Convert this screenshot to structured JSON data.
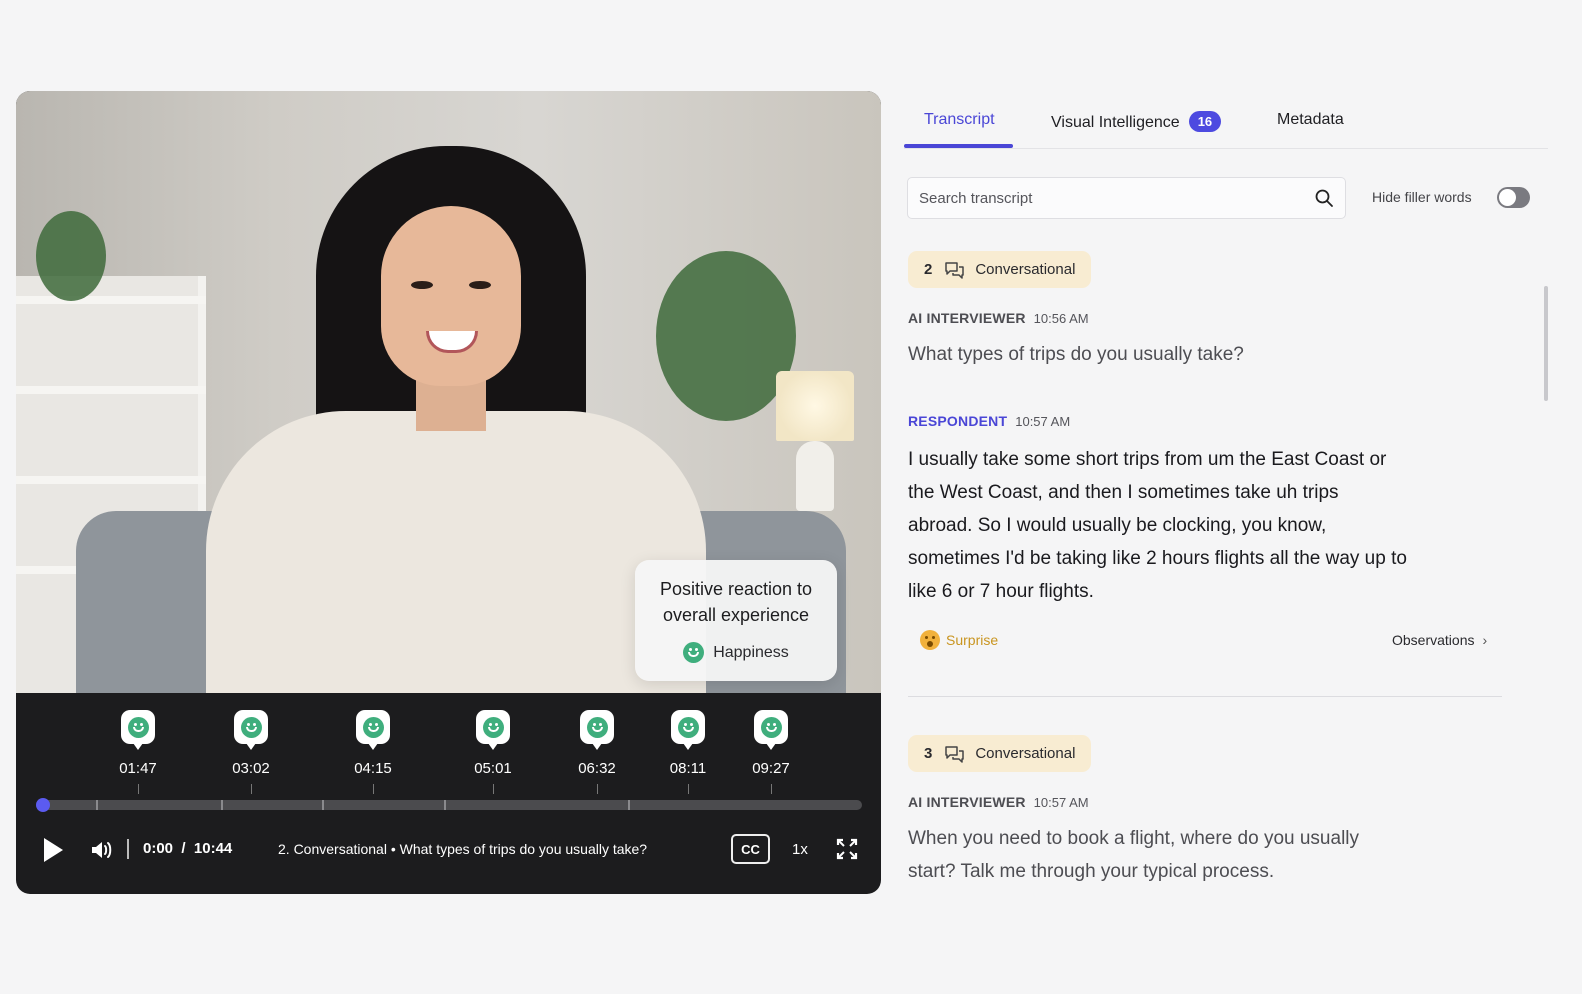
{
  "video": {
    "reaction": {
      "title": "Positive reaction to overall experience",
      "emotion": "Happiness",
      "emotion_icon": "happy-face-icon"
    },
    "markers": [
      "01:47",
      "03:02",
      "04:15",
      "05:01",
      "06:32",
      "08:11",
      "09:27"
    ],
    "current_time": "0:00",
    "separator": "/",
    "duration": "10:44",
    "now_playing": "2. Conversational • What types of trips do you usually take?",
    "cc_label": "CC",
    "speed": "1x",
    "progress_fraction": 0.0,
    "accent_color": "#5b5bf0"
  },
  "tabs": [
    {
      "label": "Transcript",
      "active": true
    },
    {
      "label": "Visual Intelligence",
      "badge": "16"
    },
    {
      "label": "Metadata"
    }
  ],
  "search": {
    "placeholder": "Search transcript"
  },
  "filler_toggle": {
    "label": "Hide filler words",
    "on": false
  },
  "transcript": [
    {
      "section_number": "2",
      "section_type": "Conversational",
      "interviewer_label": "AI INTERVIEWER",
      "interviewer_time": "10:56 AM",
      "question": "What types of trips do you usually take?",
      "respondent_label": "RESPONDENT",
      "respondent_time": "10:57 AM",
      "answer": "I usually take some short trips from um the East Coast or the West Coast, and then I sometimes take uh trips abroad. So I would usually be clocking, you know, sometimes I'd be taking like 2 hours flights all the way up to like 6 or 7 hour flights.",
      "emotion": "Surprise",
      "observations_label": "Observations"
    },
    {
      "section_number": "3",
      "section_type": "Conversational",
      "interviewer_label": "AI INTERVIEWER",
      "interviewer_time": "10:57 AM",
      "question": "When you need to book a flight, where do you usually start? Talk me through your typical process."
    }
  ]
}
